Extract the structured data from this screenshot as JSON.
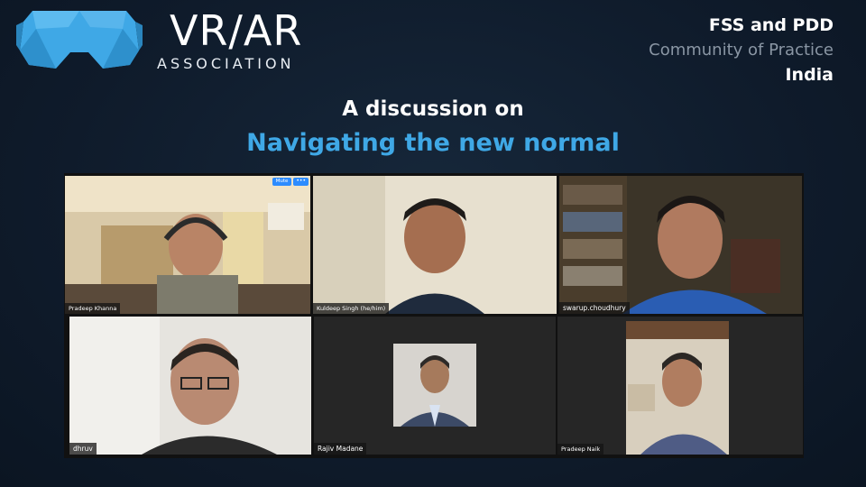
{
  "logo": {
    "title": "VR/AR",
    "subtitle": "ASSOCIATION",
    "mark_icon": "vr-headset-icon",
    "mark_color": "#3fa8e6"
  },
  "corner": {
    "line1": "FSS and PDD",
    "line2": "Community of Practice",
    "line3": "India"
  },
  "headline": {
    "line1": "A discussion on",
    "line2": "Navigating the new normal",
    "accent_color": "#3fa8e6"
  },
  "participants": [
    {
      "name": "Pradeep Khanna",
      "active_speaker": true,
      "mute_label": "Mute",
      "more_label": "•••"
    },
    {
      "name": "Kuldeep Singh (he/him)"
    },
    {
      "name": "swarup.choudhury"
    },
    {
      "name": "dhruv"
    },
    {
      "name": "Rajiv Madane"
    },
    {
      "name": "Pradeep Naik"
    }
  ]
}
